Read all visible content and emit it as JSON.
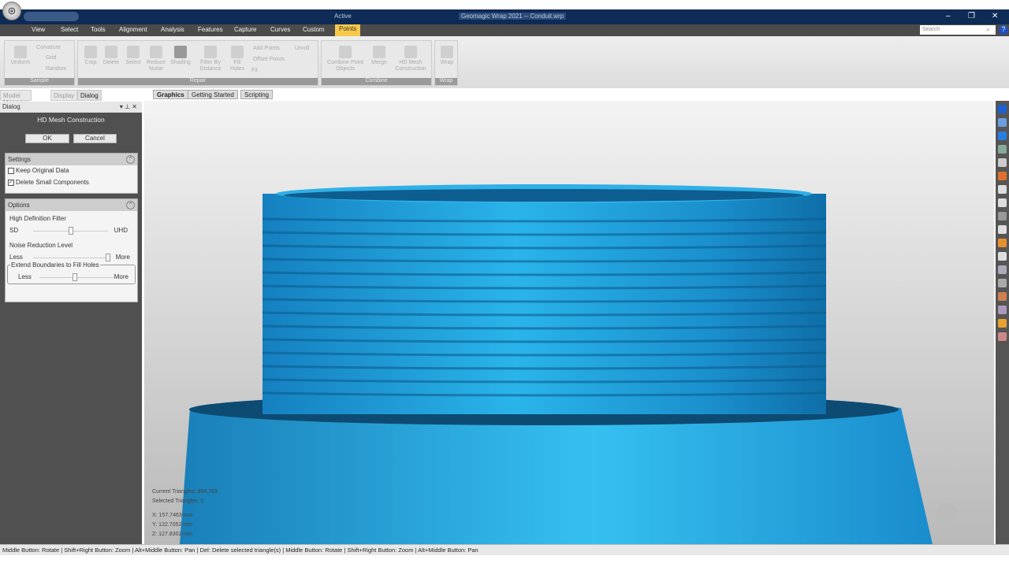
{
  "titlebar": {
    "title": "Geomagic Wrap 2021 -- Conduit.wrp",
    "context": "Active",
    "minimize": "–",
    "maximize": "❐",
    "close": "✕"
  },
  "menu": [
    "View",
    "Select",
    "Tools",
    "Alignment",
    "Analysis",
    "Features",
    "Capture",
    "Curves",
    "Custom",
    "Points"
  ],
  "search_placeholder": "Search",
  "help": "?",
  "ribbon": {
    "sample": {
      "label": "Sample",
      "items": [
        "Uniform",
        "Curvature",
        "Grid",
        "Random"
      ]
    },
    "repair": {
      "label": "Repair",
      "items": [
        "Crop",
        "Delete",
        "Select",
        "Reduce Noise",
        "Shading",
        "Filter By Distance",
        "Fill Holes",
        "Add Points",
        "Unroll",
        "Offset Points",
        "Fit"
      ]
    },
    "combine": {
      "label": "Combine",
      "items": [
        "Combine Point Objects",
        "Merge",
        "HD Mesh Construction"
      ]
    },
    "wrap": {
      "label": "Wrap",
      "items": [
        "Wrap"
      ]
    }
  },
  "panel_tabs": [
    "Model Manager",
    "Display",
    "Dialog"
  ],
  "view_tabs": [
    "Graphics",
    "Getting Started",
    "Scripting"
  ],
  "dialog": {
    "header": "Dialog",
    "title": "HD Mesh Construction",
    "ok": "OK",
    "cancel": "Cancel",
    "settings": {
      "label": "Settings",
      "keep_original": "Keep Original Data",
      "keep_checked": false,
      "delete_small": "Delete Small Components",
      "delete_checked": true
    },
    "options": {
      "label": "Options",
      "hd_filter": "High Definition Filter",
      "hd_min": "SD",
      "hd_max": "UHD",
      "hd_value": 0.5,
      "noise": "Noise Reduction Level",
      "noise_min": "Less",
      "noise_max": "More",
      "noise_value": 1.0,
      "extend": "Extend Boundaries to Fill Holes",
      "extend_min": "Less",
      "extend_max": "More",
      "extend_value": 0.5
    }
  },
  "info": {
    "current": "Current Triangles: 894,769",
    "selected": "Selected Triangles: 0",
    "x": "X:  157.7463 mm",
    "y": "Y:  122.7052 mm",
    "z": "Z:  127.8302 mm"
  },
  "status": "Middle Button: Rotate | Shift+Right Button: Zoom | Alt+Middle Button: Pan | Del: Delete selected triangle(s) | Middle Button: Rotate | Shift+Right Button: Zoom | Alt+Middle Button: Pan",
  "colors": {
    "mesh": "#1aa0dc",
    "titlebar": "#0e2b55",
    "accent": "#f7c84a"
  }
}
